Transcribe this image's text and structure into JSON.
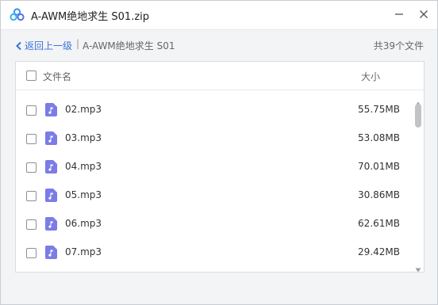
{
  "window": {
    "title": "A-AWM绝地求生 S01.zip"
  },
  "nav": {
    "back_label": "返回上一级",
    "separator": "|",
    "current_folder": "A-AWM绝地求生 S01",
    "file_count": "共39个文件"
  },
  "table": {
    "columns": {
      "name": "文件名",
      "size": "大小"
    },
    "rows": [
      {
        "name": "02.mp3",
        "size": "55.75MB"
      },
      {
        "name": "03.mp3",
        "size": "53.08MB"
      },
      {
        "name": "04.mp3",
        "size": "70.01MB"
      },
      {
        "name": "05.mp3",
        "size": "30.86MB"
      },
      {
        "name": "06.mp3",
        "size": "62.61MB"
      },
      {
        "name": "07.mp3",
        "size": "29.42MB"
      }
    ]
  },
  "icons": {
    "app": "cloud-logo-icon",
    "minimize": "minimize-icon",
    "close": "close-icon",
    "back": "chevron-left-icon",
    "file": "audio-file-icon"
  },
  "colors": {
    "accent": "#3b73d6",
    "file_icon": "#7b7ce6",
    "logo": "#3e8ef7"
  }
}
